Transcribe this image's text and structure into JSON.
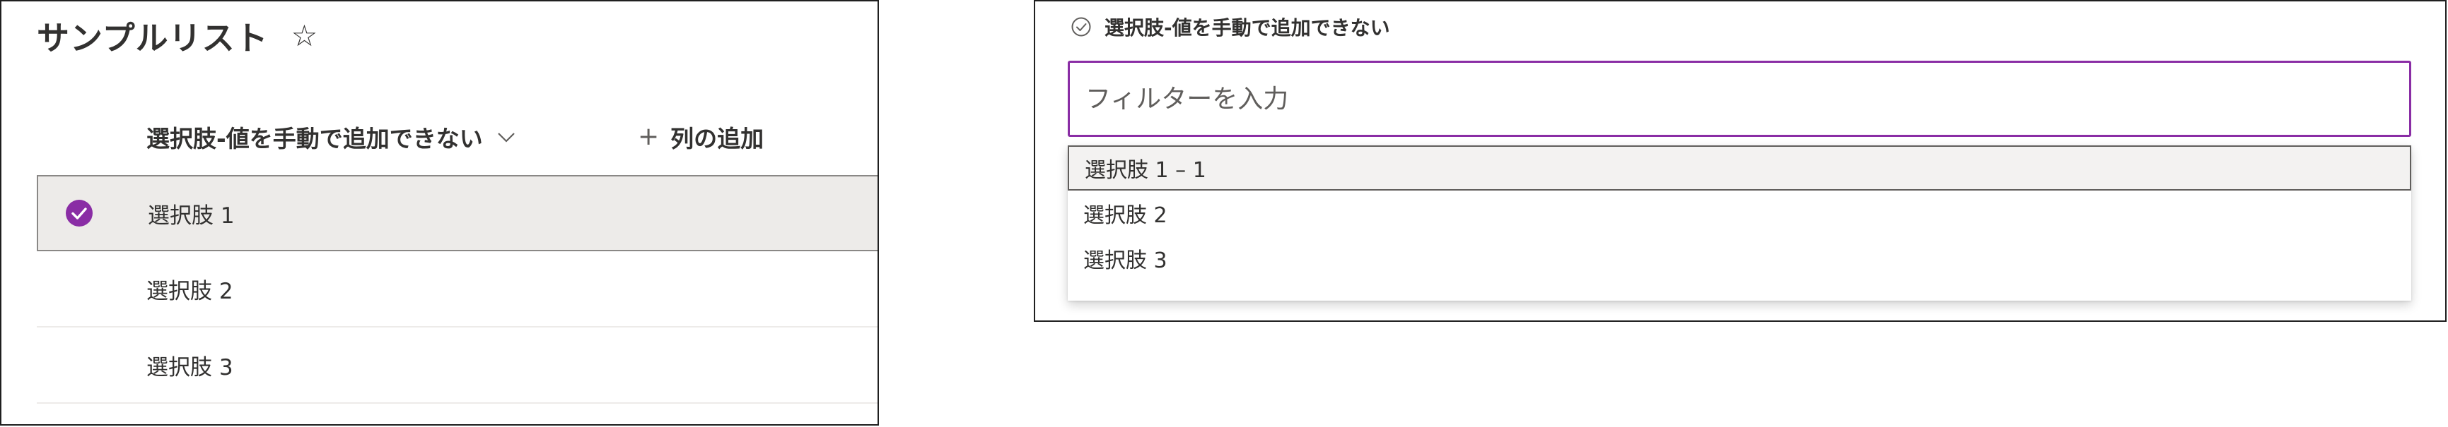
{
  "list_view": {
    "title": "サンプルリスト",
    "favorite_icon": "☆",
    "column_header": "選択肢-値を手動で追加できない",
    "add_column_label": "列の追加",
    "add_column_icon": "+",
    "rows": [
      {
        "label": "選択肢 1",
        "selected": true
      },
      {
        "label": "選択肢 2",
        "selected": false
      },
      {
        "label": "選択肢 3",
        "selected": false
      }
    ]
  },
  "dropdown": {
    "field_label": "選択肢-値を手動で追加できない",
    "filter_placeholder": "フィルターを入力",
    "options": [
      {
        "label": "選択肢 1 – 1",
        "highlighted": true
      },
      {
        "label": "選択肢 2",
        "highlighted": false
      },
      {
        "label": "選択肢 3",
        "highlighted": false
      }
    ]
  },
  "colors": {
    "accent": "#8a2da5",
    "selected_row_bg": "#edebe9",
    "text": "#323130"
  }
}
